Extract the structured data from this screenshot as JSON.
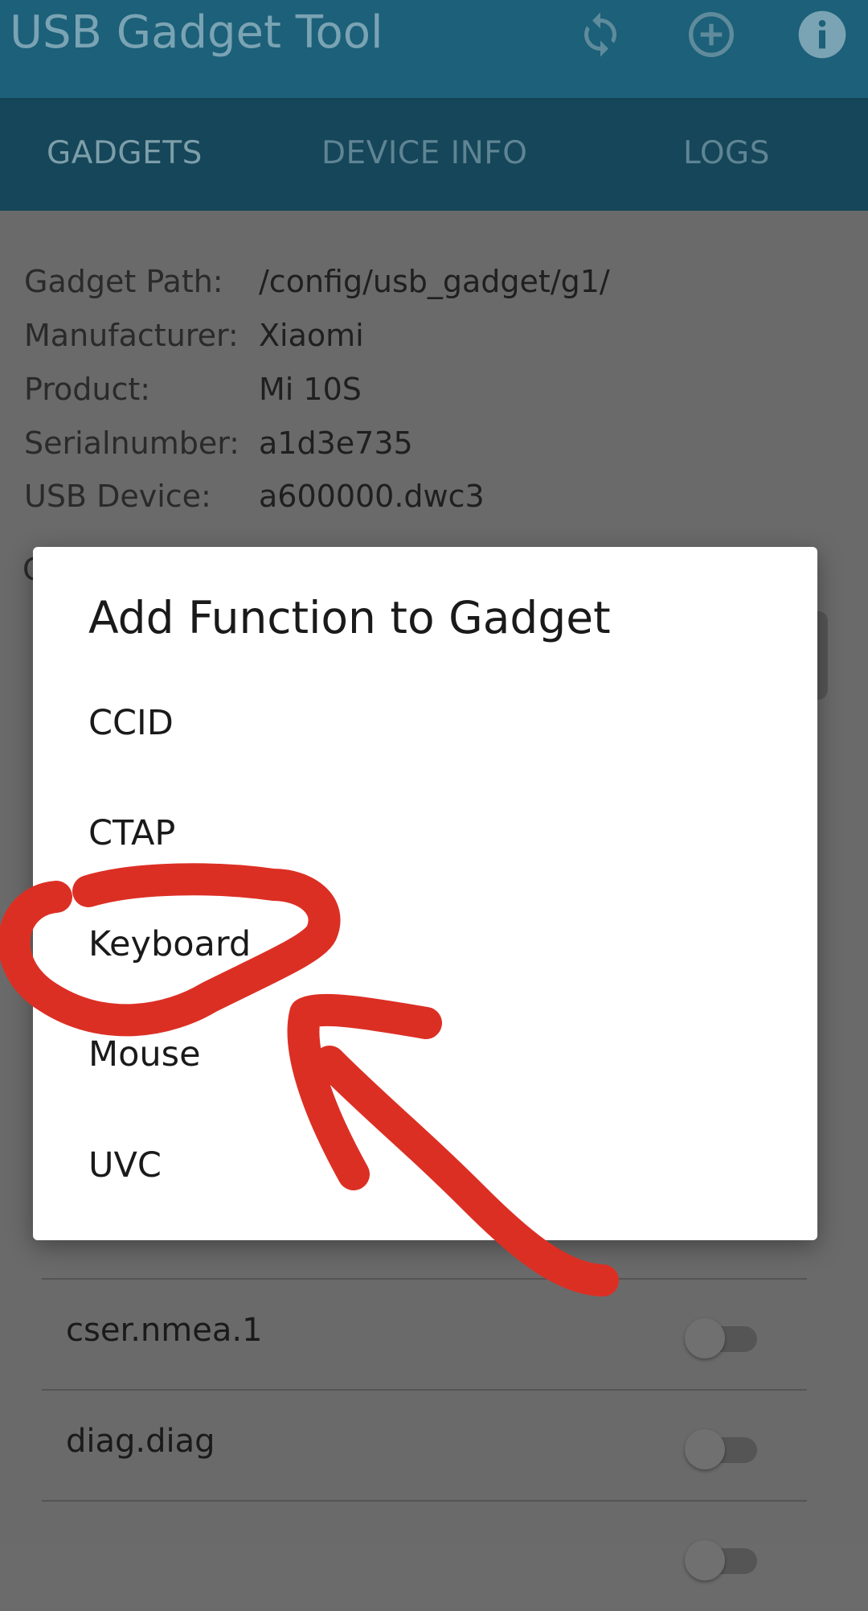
{
  "app": {
    "title": "USB Gadget Tool"
  },
  "toolbar_icons": [
    "refresh-icon",
    "add-circle-icon",
    "info-icon"
  ],
  "tabs": [
    {
      "label": "GADGETS",
      "active": true
    },
    {
      "label": "DEVICE INFO",
      "active": false
    },
    {
      "label": "LOGS",
      "active": false
    }
  ],
  "gadget_info": [
    {
      "key": "Gadget Path:",
      "value": "/config/usb_gadget/g1/"
    },
    {
      "key": "Manufacturer:",
      "value": "Xiaomi"
    },
    {
      "key": "Product:",
      "value": "Mi 10S"
    },
    {
      "key": "Serialnumber:",
      "value": "a1d3e735"
    },
    {
      "key": "USB Device:",
      "value": "a600000.dwc3"
    }
  ],
  "partial_label": "C",
  "functions": [
    {
      "label": "cser.nmea.1",
      "enabled": false
    },
    {
      "label": "diag.diag",
      "enabled": false
    }
  ],
  "dialog": {
    "title": "Add Function to Gadget",
    "options": [
      "CCID",
      "CTAP",
      "Keyboard",
      "Mouse",
      "UVC"
    ]
  },
  "colors": {
    "appbar": "#1c6079",
    "tabbar": "#154659",
    "annotation": "#dc2f24"
  }
}
